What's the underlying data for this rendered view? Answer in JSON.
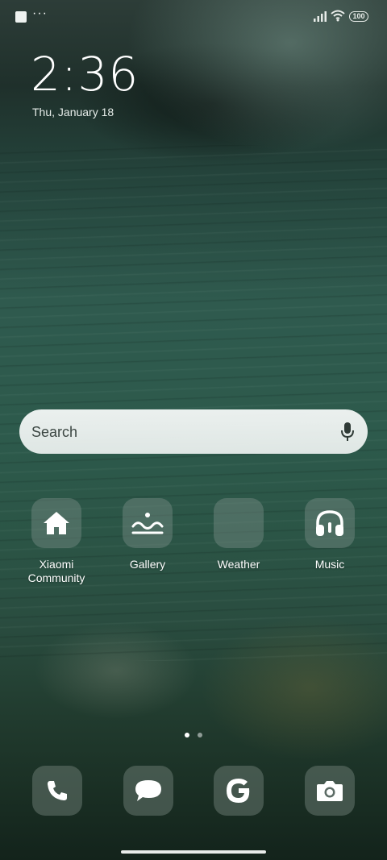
{
  "status_bar": {
    "notification_more": "···",
    "battery_level": "100",
    "icons": [
      "notification-square-icon",
      "signal-icon",
      "wifi-icon",
      "battery-icon"
    ]
  },
  "lockscreen": {
    "time": "2:36",
    "date": "Thu, January 18"
  },
  "search": {
    "placeholder": "Search",
    "mic_icon": "mic-icon"
  },
  "apps": [
    {
      "label": "Xiaomi\nCommunity",
      "icon": "home-icon"
    },
    {
      "label": "Gallery",
      "icon": "gallery-icon"
    },
    {
      "label": "Weather",
      "icon": "weather-icon"
    },
    {
      "label": "Music",
      "icon": "headphones-icon"
    }
  ],
  "page_indicator": {
    "pages": 2,
    "current": 1
  },
  "dock": [
    {
      "name": "Phone",
      "icon": "phone-icon"
    },
    {
      "name": "Messages",
      "icon": "message-icon"
    },
    {
      "name": "Google",
      "icon": "google-icon"
    },
    {
      "name": "Camera",
      "icon": "camera-icon"
    }
  ]
}
